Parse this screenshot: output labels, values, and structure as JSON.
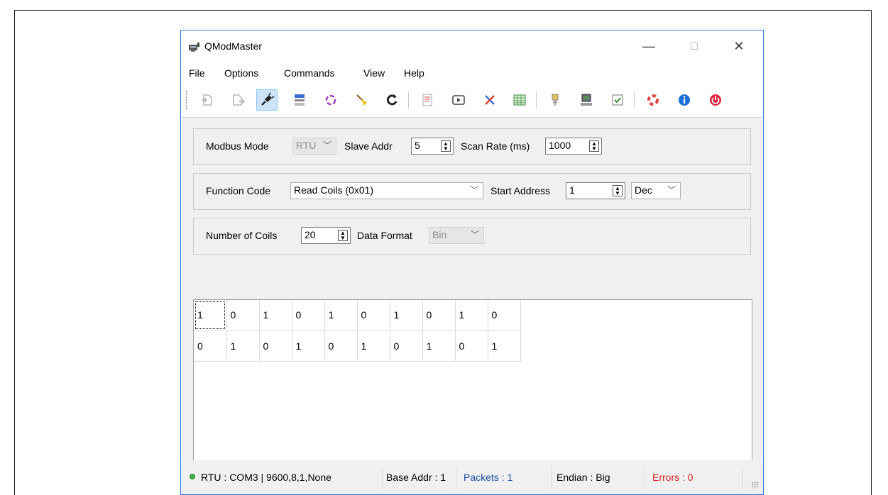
{
  "window": {
    "title": "QModMaster",
    "controls": {
      "minimize": "—",
      "maximize": "☐",
      "close": "✕"
    }
  },
  "menu": [
    "File",
    "Options",
    "Commands",
    "View",
    "Help"
  ],
  "toolbar_icons": [
    "load-session-icon",
    "save-session-icon",
    "connect-icon",
    "modbus-rtu-icon",
    "modbus-tcp-icon",
    "reset-counters-icon",
    "read-write-icon",
    "bus-monitor-icon",
    "show-monitor-icon",
    "clear-icon",
    "table-icon",
    "tools-icon",
    "header-icon",
    "options-icon",
    "about-qt-icon",
    "info-icon",
    "exit-icon"
  ],
  "settings": {
    "modbus_mode_label": "Modbus Mode",
    "modbus_mode_value": "RTU",
    "slave_addr_label": "Slave Addr",
    "slave_addr_value": "5",
    "scan_rate_label": "Scan Rate (ms)",
    "scan_rate_value": "1000"
  },
  "function": {
    "function_code_label": "Function Code",
    "function_code_value": "Read Coils (0x01)",
    "start_address_label": "Start Address",
    "start_address_value": "1",
    "base_format_value": "Dec"
  },
  "coils": {
    "number_label": "Number of Coils",
    "number_value": "20",
    "data_format_label": "Data Format",
    "data_format_value": "Bin"
  },
  "grid": {
    "rows": [
      [
        "1",
        "0",
        "1",
        "0",
        "1",
        "0",
        "1",
        "0",
        "1",
        "0"
      ],
      [
        "0",
        "1",
        "0",
        "1",
        "0",
        "1",
        "0",
        "1",
        "0",
        "1"
      ]
    ]
  },
  "status": {
    "connection": "RTU : COM3 | 9600,8,1,None",
    "base_addr": "Base Addr : 1",
    "packets": "Packets : 1",
    "endian": "Endian : Big",
    "errors": "Errors : 0"
  },
  "colors": {
    "accent": "#2b79d7",
    "packets": "#1f4fa8",
    "errors": "#e02020",
    "led": "#3cb043"
  }
}
